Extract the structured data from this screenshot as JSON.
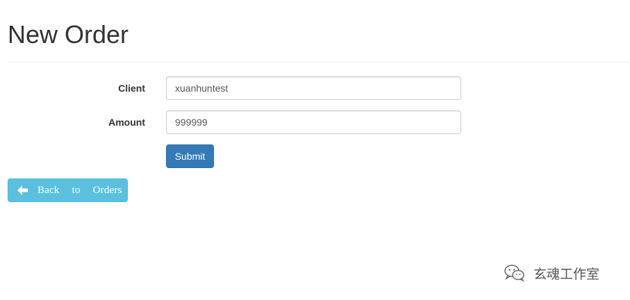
{
  "page": {
    "title": "New Order"
  },
  "form": {
    "client": {
      "label": "Client",
      "value": "xuanhuntest"
    },
    "amount": {
      "label": "Amount",
      "value": "999999"
    },
    "submit_label": "Submit"
  },
  "nav": {
    "back_label": "Back to Orders",
    "back_icon": "arrow-left-icon"
  },
  "watermark": {
    "icon": "wechat-icon",
    "text": "玄魂工作室"
  },
  "colors": {
    "primary": "#337ab7",
    "info": "#5bc0de",
    "text": "#333333"
  }
}
